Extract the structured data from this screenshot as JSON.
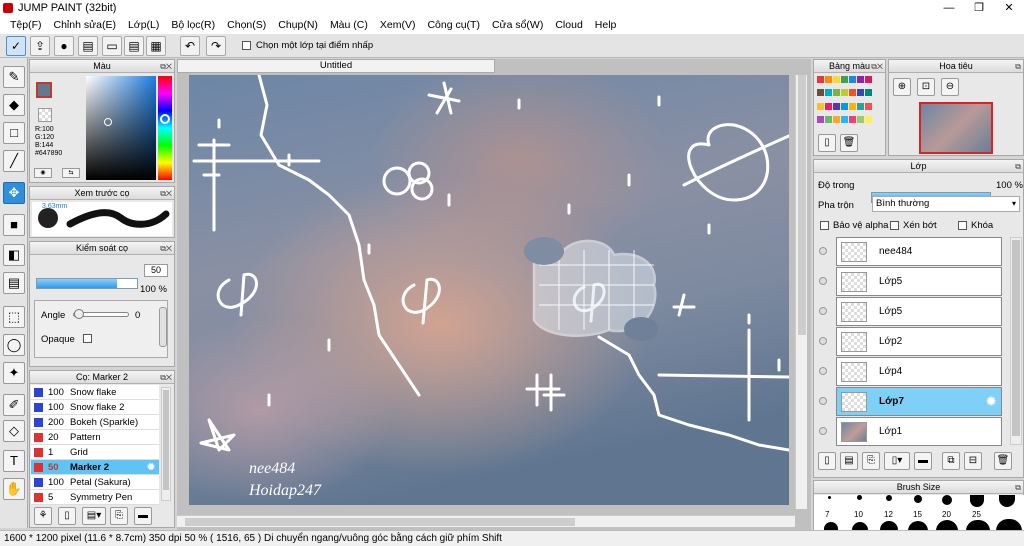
{
  "window": {
    "title": "JUMP PAINT (32bit)",
    "min": "—",
    "max": "❐",
    "close": "✕"
  },
  "menu": [
    "Tệp(F)",
    "Chỉnh sửa(E)",
    "Lớp(L)",
    "Bộ lọc(R)",
    "Chọn(S)",
    "Chụp(N)",
    "Màu (C)",
    "Xem(V)",
    "Công cụ(T)",
    "Cửa sổ(W)",
    "Cloud",
    "Help"
  ],
  "toolbar": {
    "checkbox_label": "Chọn một lớp tại điểm nhấp"
  },
  "canvas": {
    "tab_title": "Untitled",
    "watermark1": "nee484",
    "watermark2": "Hoidap247"
  },
  "color_panel": {
    "title": "Màu",
    "r": "R:100",
    "g": "G:120",
    "b": "B:144",
    "hex": "#647890",
    "fg": "#647890"
  },
  "brush_preview": {
    "title": "Xem trước cọ",
    "size": "3.63mm"
  },
  "brush_control": {
    "title": "Kiểm soát cọ",
    "size": "50",
    "opacity": "100 %",
    "size_frac": 0.8,
    "opacity_frac": 1.0,
    "angle_label": "Angle",
    "angle_value": "0",
    "opaque_label": "Opaque"
  },
  "brush_list": {
    "title": "Cọ: Marker 2",
    "items": [
      {
        "size": "100",
        "name": "Snow flake",
        "color": "#2b44d8"
      },
      {
        "size": "100",
        "name": "Snow flake 2",
        "color": "#2b44d8"
      },
      {
        "size": "200",
        "name": "Bokeh (Sparkle)",
        "color": "#2b44d8"
      },
      {
        "size": "20",
        "name": "Pattern",
        "color": "#e03030"
      },
      {
        "size": "1",
        "name": "Grid",
        "color": "#e03030"
      },
      {
        "size": "50",
        "name": "Marker 2",
        "color": "#e03030"
      },
      {
        "size": "100",
        "name": "Petal (Sakura)",
        "color": "#2b44d8"
      },
      {
        "size": "5",
        "name": "Symmetry Pen",
        "color": "#e03030"
      }
    ]
  },
  "swatches": {
    "title": "Bảng màu",
    "colors": [
      "#e53935",
      "#fb8c00",
      "#fdd835",
      "#43a047",
      "#1e88e5",
      "#8e24aa",
      "#d81b60",
      "#6d4c41",
      "#00acc1",
      "#7cb342",
      "#c0ca33",
      "#f4511e",
      "#3949ab",
      "#00897b",
      "#fbc02d",
      "#e91e63",
      "#5e35b1",
      "#039be5",
      "#ffb300",
      "#26a69a",
      "#ef5350",
      "#ab47bc",
      "#66bb6a",
      "#ffa726",
      "#29b6f6",
      "#ec407a",
      "#9ccc65",
      "#ffee58"
    ]
  },
  "navigator": {
    "title": "Hoa tiêu"
  },
  "layers": {
    "title": "Lớp",
    "opacity_label": "Độ trong",
    "opacity_value": "100 %",
    "opacity_frac": 1.0,
    "blend_label": "Pha trộn",
    "blend_value": "Bình thường",
    "protect_alpha": "Bảo vệ alpha",
    "clip": "Xén bớt",
    "lock": "Khóa",
    "items": [
      {
        "name": "nee484",
        "selected": false
      },
      {
        "name": "Lớp5",
        "selected": false
      },
      {
        "name": "Lớp5",
        "selected": false
      },
      {
        "name": "Lớp2",
        "selected": false
      },
      {
        "name": "Lớp4",
        "selected": false
      },
      {
        "name": "Lớp7",
        "selected": true
      },
      {
        "name": "Lớp1",
        "selected": false
      }
    ]
  },
  "brush_size": {
    "title": "Brush Size",
    "labels": [
      "7",
      "10",
      "12",
      "15",
      "20",
      "25"
    ]
  },
  "status": {
    "text": "1600 * 1200 pixel  (11.6 * 8.7cm)  350 dpi  50 %  ( 1516, 65 )  Di chuyển ngang/vuông góc bằng cách giữ phím Shift"
  }
}
